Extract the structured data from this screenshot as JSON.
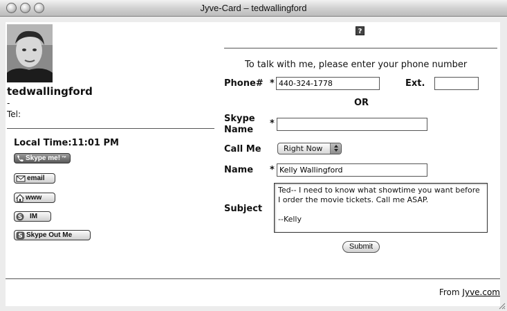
{
  "window": {
    "title": "Jyve-Card – tedwallingford"
  },
  "profile": {
    "username": "tedwallingford",
    "dash": "-",
    "tel_label": "Tel:",
    "local_time": "Local Time:11:01 PM"
  },
  "buttons": {
    "skype_me": "Skype me!",
    "skype_me_tm": "™",
    "email": "email",
    "www": "www",
    "im": "IM",
    "skype_out": "Skype Out Me"
  },
  "form": {
    "help": "?",
    "prompt": "To talk with me, please enter your phone number",
    "phone_label": "Phone#",
    "required_mark": "*",
    "phone_value": "440-324-1778",
    "ext_label": "Ext.",
    "ext_value": "",
    "or_label": "OR",
    "skype_label": "Skype Name",
    "skype_value": "",
    "callme_label": "Call Me",
    "callme_value": "Right Now",
    "name_label": "Name",
    "name_value": "Kelly Wallingford",
    "subject_label": "Subject",
    "subject_value": "Ted-- I need to know what showtime you want before I order the movie tickets. Call me ASAP.\n\n--Kelly",
    "submit_label": "Submit"
  },
  "footer": {
    "from": "From",
    "link": "Jyve.com"
  },
  "colors": {
    "skype_me_bg": "#6e6e6e",
    "page_bg": "#ffffff"
  }
}
